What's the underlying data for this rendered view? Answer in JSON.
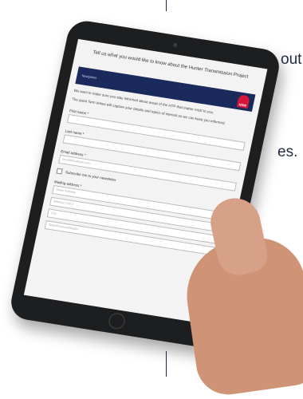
{
  "background": {
    "line1_fragment": "out",
    "line2_fragment": "es."
  },
  "screen": {
    "title": "Tell us what you would like to know about the Hunter Transmission Project",
    "nav_label": "Navigation",
    "logo_text": "NSW",
    "intro_1": "We want to make sure you stay informed about areas of the HTP that matter most to you.",
    "intro_2": "The quick form below will capture your details and topics of interest so we can keep you informed.",
    "first_name_label": "First name *",
    "last_name_label": "Last name *",
    "email_label": "Email address *",
    "email_placeholder": "email@example.com",
    "newsletter_label": "Subscribe me to your newsletter",
    "mailing_label": "Mailing address *",
    "street_placeholder": "Street Address",
    "line2_placeholder": "Address Line 2",
    "city_placeholder": "City",
    "state_placeholder": "State/Province/Region"
  },
  "colors": {
    "nav": "#1b2a5c",
    "logo": "#d7153a",
    "text": "#1f2a44"
  }
}
